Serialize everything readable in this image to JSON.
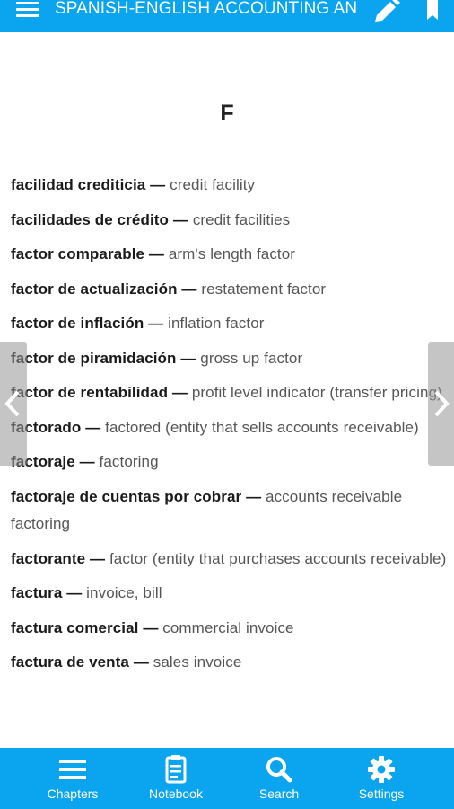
{
  "header": {
    "title": "SPANISH-ENGLISH ACCOUNTING AN",
    "icons": {
      "menu": "hamburger-menu-icon",
      "edit": "pencil-icon",
      "bookmark": "bookmark-icon"
    }
  },
  "section_letter": "F",
  "entries": [
    {
      "term": "facilidad crediticia",
      "translation": "credit facility"
    },
    {
      "term": "facilidades de crédito",
      "translation": "credit facilities"
    },
    {
      "term": "factor comparable",
      "translation": "arm's length factor"
    },
    {
      "term": "factor de actualización",
      "translation": "restatement factor"
    },
    {
      "term": "factor de inflación",
      "translation": "inflation factor"
    },
    {
      "term": "factor de piramidación",
      "translation": "gross up factor"
    },
    {
      "term": "factor de rentabilidad",
      "translation": "profit level indicator (transfer pricing)"
    },
    {
      "term": "factorado",
      "translation": "factored (entity that sells accounts receivable)"
    },
    {
      "term": "factoraje",
      "translation": "factoring"
    },
    {
      "term": "factoraje de cuentas por cobrar",
      "translation": "accounts receivable factoring"
    },
    {
      "term": "factorante",
      "translation": "factor (entity that purchases accounts receivable)"
    },
    {
      "term": "factura",
      "translation": "invoice, bill"
    },
    {
      "term": "factura comercial",
      "translation": "commercial invoice"
    },
    {
      "term": "factura de venta",
      "translation": "sales invoice"
    }
  ],
  "separator": "—",
  "bottom_nav": [
    {
      "label": "Chapters",
      "icon": "list-icon"
    },
    {
      "label": "Notebook",
      "icon": "notebook-icon"
    },
    {
      "label": "Search",
      "icon": "search-icon"
    },
    {
      "label": "Settings",
      "icon": "gear-icon"
    }
  ],
  "colors": {
    "accent": "#0aa5ee",
    "term_text": "#1a1a1a",
    "translation_text": "#555555"
  }
}
